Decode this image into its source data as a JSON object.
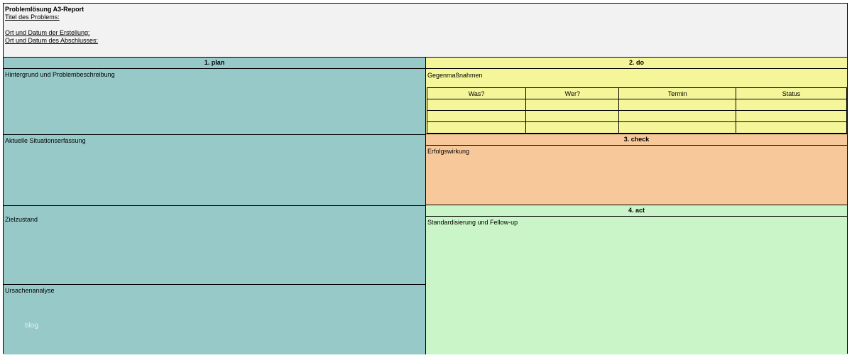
{
  "header": {
    "title": "Problemlösung A3-Report",
    "problem_title_label": "Titel des Problems:",
    "creation_label": "Ort und Datum der Erstellung:",
    "closure_label": "Ort und Datum des Abschlusses:"
  },
  "plan": {
    "heading": "1.  plan",
    "background": "Hintergrund und Problembeschreibung",
    "current_state": "Aktuelle Situationserfassung",
    "target_state": "Zielzustand",
    "root_cause": "Ursachenanalyse",
    "color": "#96c9c8"
  },
  "do": {
    "heading": "2. do",
    "countermeasures": "Gegenmaßnahmen",
    "table_headers": [
      "Was?",
      "Wer?",
      "Termin",
      "Status"
    ],
    "color": "#f5f59a"
  },
  "check": {
    "heading": "3. check",
    "effect": "Erfolgswirkung",
    "color": "#f7c99a"
  },
  "act": {
    "heading": "4. act",
    "standardization": "Standardisierung und Fellow-up",
    "color": "#caf5c9"
  },
  "watermark": "blog"
}
